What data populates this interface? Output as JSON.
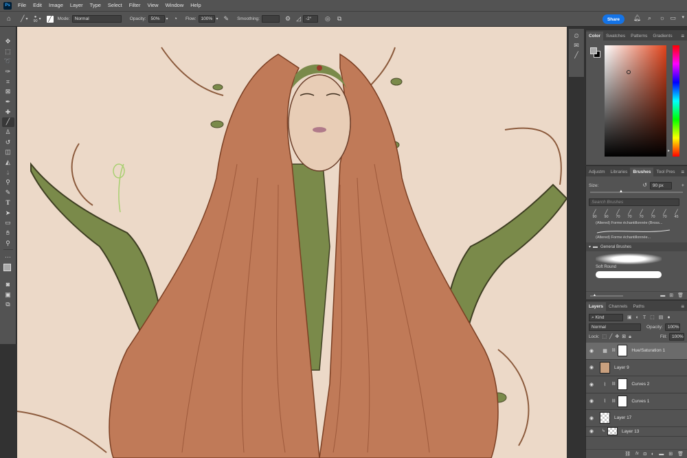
{
  "menubar": {
    "logo": "Ps",
    "items": [
      "File",
      "Edit",
      "Image",
      "Layer",
      "Type",
      "Select",
      "Filter",
      "View",
      "Window",
      "Help"
    ]
  },
  "options": {
    "brush_size": "90",
    "mode_label": "Mode:",
    "mode_value": "Normal",
    "opacity_label": "Opacity:",
    "opacity_value": "50%",
    "flow_label": "Flow:",
    "flow_value": "100%",
    "smoothing_label": "Smoothing:",
    "angle_value": "-2°",
    "share_label": "Share"
  },
  "color_panel": {
    "tabs": [
      "Color",
      "Swatches",
      "Patterns",
      "Gradients"
    ],
    "hue_color": "#e0441c"
  },
  "brushes_panel": {
    "tabs": [
      "Adjustm",
      "Libraries",
      "Brushes",
      "Tool Pres"
    ],
    "size_label": "Size:",
    "size_value": "90 px",
    "search_placeholder": "Search Brushes",
    "recent_sizes": [
      "90",
      "90",
      "70",
      "70",
      "70",
      "70",
      "70",
      "45"
    ],
    "altered_item_1": "(Altered) Forme échantillonnée (Bross...",
    "altered_item_2": "(Altered) Forme échantillonnée...",
    "group_name": "General Brushes",
    "brush_name": "Soft Round"
  },
  "layers_panel": {
    "tabs": [
      "Layers",
      "Channels",
      "Paths"
    ],
    "filter_label": "Kind",
    "blend_mode": "Normal",
    "opacity_label": "Opacity:",
    "opacity_value": "100%",
    "lock_label": "Lock:",
    "fill_label": "Fill:",
    "fill_value": "100%",
    "layers": [
      {
        "name": "Hue/Saturation 1",
        "kind": "adjustment",
        "selected": true
      },
      {
        "name": "Layer 9",
        "kind": "pixel-solid"
      },
      {
        "name": "Curves 2",
        "kind": "adjustment"
      },
      {
        "name": "Curves 1",
        "kind": "adjustment"
      },
      {
        "name": "Layer 17",
        "kind": "pixel-transparent"
      },
      {
        "name": "Layer 13",
        "kind": "pixel-transparent"
      }
    ]
  },
  "colors": {
    "canvas_bg": "#ecd9c8",
    "hair": "#c07a58",
    "vine_green": "#7a8a4a",
    "accent_blue": "#1473e6"
  }
}
